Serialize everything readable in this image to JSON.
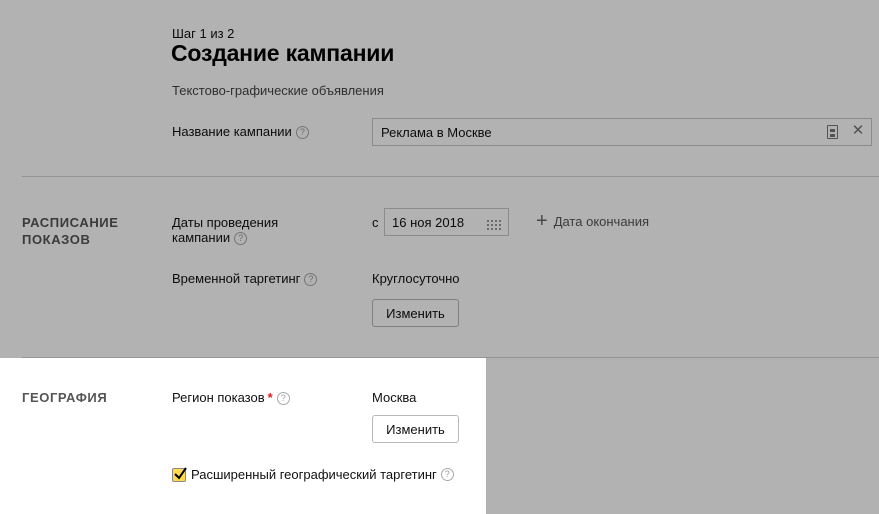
{
  "header": {
    "step": "Шаг 1 из 2",
    "title": "Создание кампании",
    "subtitle": "Текстово-графические объявления"
  },
  "campaign_name": {
    "label": "Название кампании",
    "help": "?",
    "value": "Реклама в Москве"
  },
  "schedule": {
    "section_title": "РАСПИСАНИЕ ПОКАЗОВ",
    "dates": {
      "label": "Даты проведения кампании",
      "help": "?",
      "from_prefix": "с",
      "start_date": "16 ноя 2018",
      "add_end_date": "Дата окончания",
      "add_icon": "+"
    },
    "time_targeting": {
      "label": "Временной таргетинг",
      "help": "?",
      "value": "Круглосуточно",
      "change_button": "Изменить"
    }
  },
  "geography": {
    "section_title": "ГЕОГРАФИЯ",
    "region": {
      "label": "Регион показов",
      "required_mark": "*",
      "help": "?",
      "value": "Москва",
      "change_button": "Изменить"
    },
    "extended": {
      "checked": true,
      "label": "Расширенный географический таргетинг",
      "help": "?"
    }
  },
  "colors": {
    "overlay": "#000000",
    "checkbox_fill": "#ffdb4d",
    "required": "#e21a1a"
  }
}
